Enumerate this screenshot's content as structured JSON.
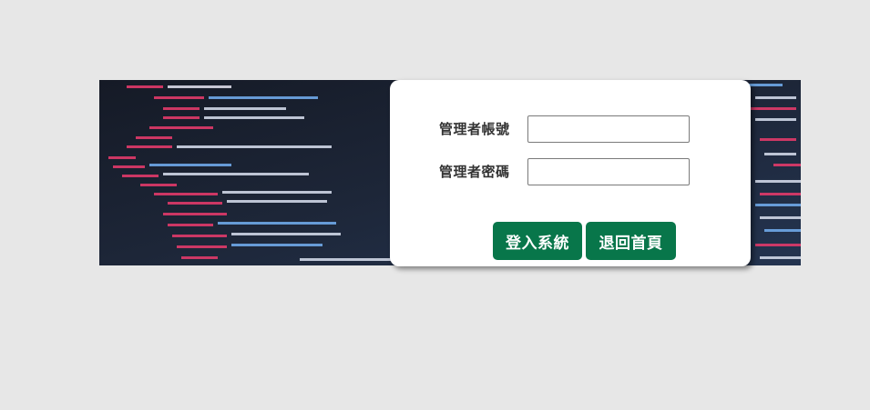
{
  "colors": {
    "page_background": "#e7e7e7",
    "card_background": "#ffffff",
    "button_background": "#08764a",
    "button_text": "#ffffff"
  },
  "banner": {
    "image_description_icon": "code-editor-image"
  },
  "form": {
    "account_label": "管理者帳號",
    "account_value": "",
    "password_label": "管理者密碼",
    "password_value": "",
    "login_button": "登入系統",
    "back_button": "退回首頁"
  }
}
